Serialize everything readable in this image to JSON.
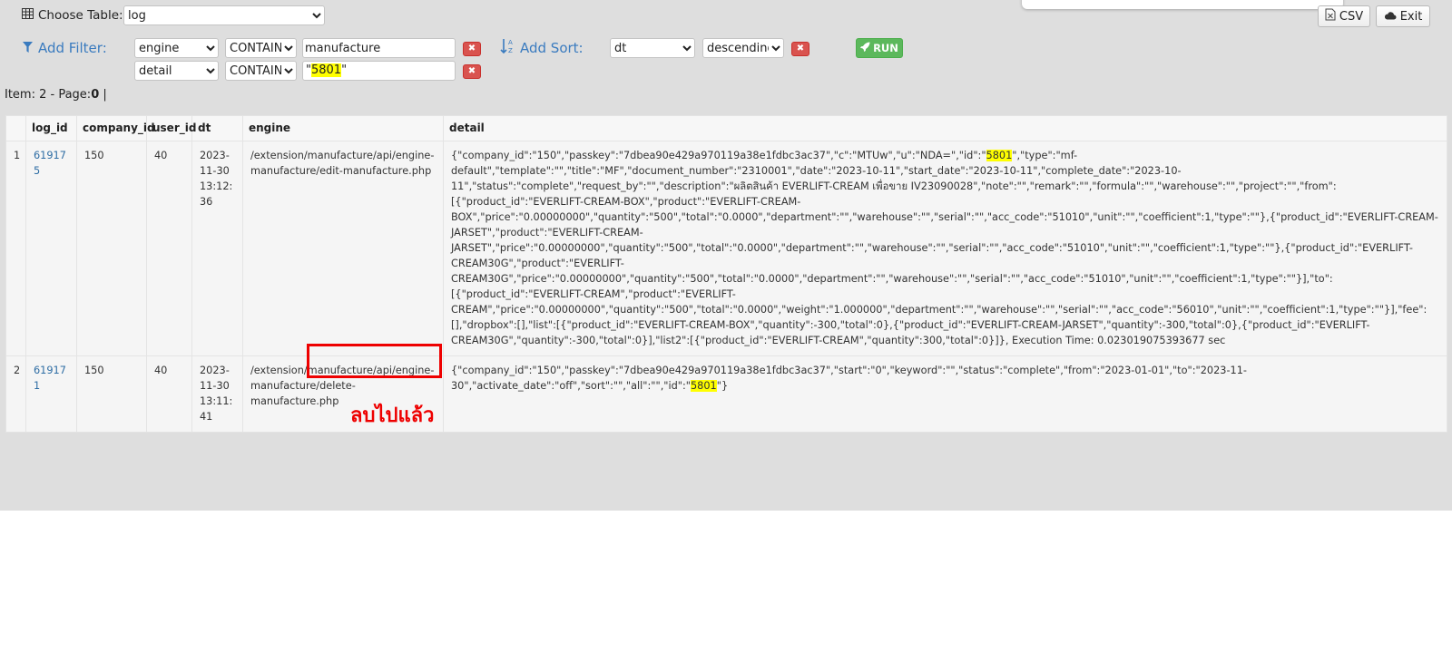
{
  "header": {
    "choose_table_label": "Choose Table:",
    "table_value": "log",
    "csv_label": "CSV",
    "exit_label": "Exit"
  },
  "filters": {
    "add_filter_label": "Add Filter:",
    "rows": [
      {
        "field": "engine",
        "op": "CONTAIN",
        "value": "manufacture"
      },
      {
        "field": "detail",
        "op": "CONTAIN",
        "value_prefix": "\"",
        "value_highlight": "5801",
        "value_suffix": "\""
      }
    ]
  },
  "sort": {
    "add_sort_label": "Add Sort:",
    "field": "dt",
    "direction": "descending",
    "run_label": "RUN"
  },
  "results": {
    "item_prefix": "Item: 2 - Page:",
    "page": "0",
    "page_suffix": " |",
    "columns": [
      "",
      "log_id",
      "company_id",
      "user_id",
      "dt",
      "engine",
      "detail"
    ],
    "rows": [
      {
        "index": "1",
        "log_id": "619175",
        "company_id": "150",
        "user_id": "40",
        "dt": "2023-11-30 13:12:36",
        "engine": "/extension/manufacture/api/engine-manufacture/edit-manufacture.php",
        "detail_before": "{\"company_id\":\"150\",\"passkey\":\"7dbea90e429a970119a38e1fdbc3ac37\",\"c\":\"MTUw\",\"u\":\"NDA=\",\"id\":\"",
        "detail_highlight": "5801",
        "detail_after": "\",\"type\":\"mf-default\",\"template\":\"\",\"title\":\"MF\",\"document_number\":\"2310001\",\"date\":\"2023-10-11\",\"start_date\":\"2023-10-11\",\"complete_date\":\"2023-10-11\",\"status\":\"complete\",\"request_by\":\"\",\"description\":\"ผลิตสินค้า EVERLIFT-CREAM เพื่อขาย IV23090028\",\"note\":\"\",\"remark\":\"\",\"formula\":\"\",\"warehouse\":\"\",\"project\":\"\",\"from\":[{\"product_id\":\"EVERLIFT-CREAM-BOX\",\"product\":\"EVERLIFT-CREAM-BOX\",\"price\":\"0.00000000\",\"quantity\":\"500\",\"total\":\"0.0000\",\"department\":\"\",\"warehouse\":\"\",\"serial\":\"\",\"acc_code\":\"51010\",\"unit\":\"\",\"coefficient\":1,\"type\":\"\"},{\"product_id\":\"EVERLIFT-CREAM-JARSET\",\"product\":\"EVERLIFT-CREAM-JARSET\",\"price\":\"0.00000000\",\"quantity\":\"500\",\"total\":\"0.0000\",\"department\":\"\",\"warehouse\":\"\",\"serial\":\"\",\"acc_code\":\"51010\",\"unit\":\"\",\"coefficient\":1,\"type\":\"\"},{\"product_id\":\"EVERLIFT-CREAM30G\",\"product\":\"EVERLIFT-CREAM30G\",\"price\":\"0.00000000\",\"quantity\":\"500\",\"total\":\"0.0000\",\"department\":\"\",\"warehouse\":\"\",\"serial\":\"\",\"acc_code\":\"51010\",\"unit\":\"\",\"coefficient\":1,\"type\":\"\"}],\"to\":[{\"product_id\":\"EVERLIFT-CREAM\",\"product\":\"EVERLIFT-CREAM\",\"price\":\"0.00000000\",\"quantity\":\"500\",\"total\":\"0.0000\",\"weight\":\"1.000000\",\"department\":\"\",\"warehouse\":\"\",\"serial\":\"\",\"acc_code\":\"56010\",\"unit\":\"\",\"coefficient\":1,\"type\":\"\"}],\"fee\":[],\"dropbox\":[],\"list\":[{\"product_id\":\"EVERLIFT-CREAM-BOX\",\"quantity\":-300,\"total\":0},{\"product_id\":\"EVERLIFT-CREAM-JARSET\",\"quantity\":-300,\"total\":0},{\"product_id\":\"EVERLIFT-CREAM30G\",\"quantity\":-300,\"total\":0}],\"list2\":[{\"product_id\":\"EVERLIFT-CREAM\",\"quantity\":300,\"total\":0}]}, Execution Time: 0.023019075393677 sec"
      },
      {
        "index": "2",
        "log_id": "619171",
        "company_id": "150",
        "user_id": "40",
        "dt": "2023-11-30 13:11:41",
        "engine": "/extension/manufacture/api/engine-manufacture/delete-manufacture.php",
        "detail_before": "{\"company_id\":\"150\",\"passkey\":\"7dbea90e429a970119a38e1fdbc3ac37\",\"start\":\"0\",\"keyword\":\"\",\"status\":\"complete\",\"from\":\"2023-01-01\",\"to\":\"2023-11-30\",\"activate_date\":\"off\",\"sort\":\"\",\"all\":\"\",\"id\":\"",
        "detail_highlight": "5801",
        "detail_after": "\"}"
      }
    ]
  },
  "annotation": {
    "text": "ลบไปแล้ว",
    "color": "#ee0000"
  },
  "colors": {
    "link": "#3a7bbf",
    "run": "#5cb85c",
    "remove": "#d9534f",
    "highlight": "#ffff00"
  },
  "icons": [
    "table-icon",
    "filter-icon",
    "sort-az-icon",
    "csv-icon",
    "cloud-icon",
    "rocket-icon",
    "remove-icon"
  ]
}
